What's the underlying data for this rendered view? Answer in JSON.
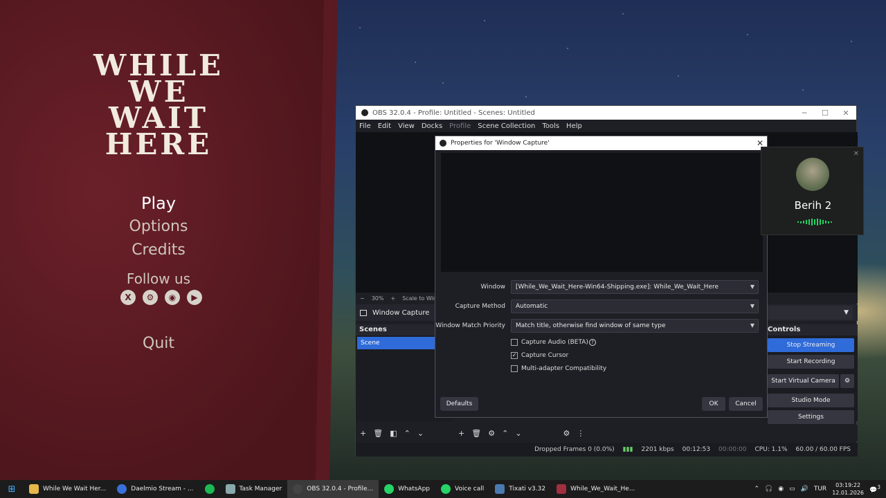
{
  "game": {
    "title_lines": [
      "WHILE",
      "WE",
      "WAIT",
      "HERE"
    ],
    "menu": {
      "play": "Play",
      "options": "Options",
      "credits": "Credits",
      "follow": "Follow us",
      "quit": "Quit"
    },
    "socials": [
      "x-icon",
      "steam-icon",
      "discord-icon",
      "youtube-icon"
    ]
  },
  "obs": {
    "title": "OBS 32.0.4 - Profile: Untitled - Scenes: Untitled",
    "menu": [
      "File",
      "Edit",
      "View",
      "Docks",
      "Profile",
      "Scene Collection",
      "Tools",
      "Help"
    ],
    "zoom": "30%",
    "scale_label": "Scale to Windo",
    "source_name": "Window Capture",
    "scenes_title": "Scenes",
    "scene_item": "Scene",
    "controls_title": "Controls",
    "controls": [
      "Stop Streaming",
      "Start Recording",
      "Start Virtual Camera",
      "Studio Mode",
      "Settings"
    ],
    "status": {
      "dropped": "Dropped Frames 0 (0.0%)",
      "kbps": "2201 kbps",
      "stream_time": "00:12:53",
      "rec_time": "00:00:00",
      "cpu": "CPU: 1.1%",
      "fps": "60.00 / 60.00 FPS"
    }
  },
  "dialog": {
    "title": "Properties for 'Window Capture'",
    "window_label": "Window",
    "window_value": "[While_We_Wait_Here-Win64-Shipping.exe]: While_We_Wait_Here",
    "method_label": "Capture Method",
    "method_value": "Automatic",
    "priority_label": "Window Match Priority",
    "priority_value": "Match title, otherwise find window of same type",
    "chk_audio": "Capture Audio (BETA)",
    "chk_cursor": "Capture Cursor",
    "chk_multi": "Multi-adapter Compatibility",
    "cursor_checked": "✓",
    "defaults": "Defaults",
    "ok": "OK",
    "cancel": "Cancel"
  },
  "voice": {
    "name": "Berih 2"
  },
  "taskbar": {
    "items": [
      "While We Wait Her...",
      "Daelmio Stream - ...",
      "Task Manager",
      "OBS 32.0.4 - Profile...",
      "WhatsApp",
      "Voice call",
      "Tixati v3.32",
      "While_We_Wait_He..."
    ],
    "lang": "TUR",
    "time": "03:19:22",
    "date": "12.01.2026",
    "notif": "3"
  }
}
